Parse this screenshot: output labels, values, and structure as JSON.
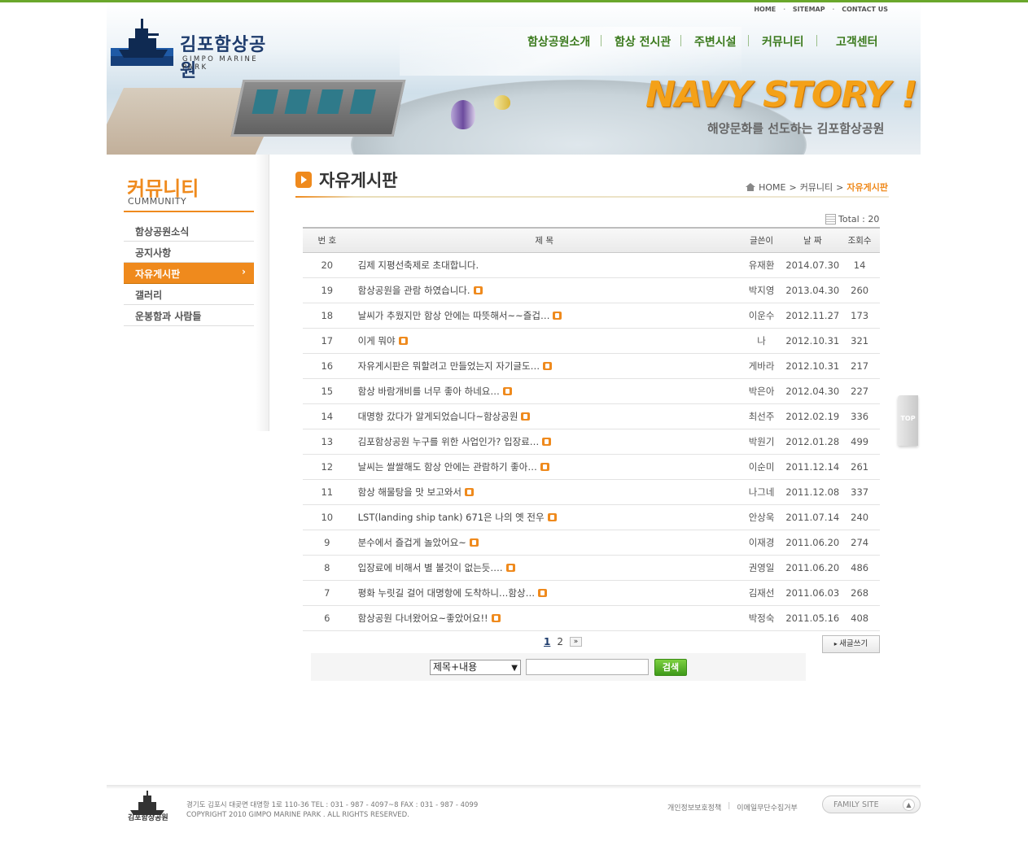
{
  "header": {
    "logo_title": "김포함상공원",
    "logo_sub": "GIMPO MARINE PARK",
    "util_links": [
      "HOME",
      "SITEMAP",
      "CONTACT US"
    ],
    "gnb": [
      "함상공원소개",
      "함상 전시관",
      "주변시설",
      "커뮤니티",
      "고객센터"
    ],
    "banner_title": "NAVY STORY !",
    "banner_sub": "해양문화를 선도하는 김포함상공원"
  },
  "lnb": {
    "title": "커뮤니티",
    "sub": "CUMMUNITY",
    "items": [
      "함상공원소식",
      "공지사항",
      "자유게시판",
      "갤러리",
      "운봉함과 사람들"
    ],
    "active_index": 2
  },
  "content": {
    "title": "자유게시판",
    "breadcrumb": [
      "HOME",
      ">",
      "커뮤니티",
      ">",
      "자유게시판"
    ],
    "total_label": "Total : 20"
  },
  "board": {
    "columns": [
      "번 호",
      "제 목",
      "글쓴이",
      "날 짜",
      "조회수"
    ],
    "rows": [
      {
        "no": "20",
        "title": "김제 지평선축제로 초대합니다.",
        "author": "유재환",
        "date": "2014.07.30",
        "views": "14",
        "new": false
      },
      {
        "no": "19",
        "title": "함상공원을 관람 하였습니다.",
        "author": "박지영",
        "date": "2013.04.30",
        "views": "260",
        "new": true
      },
      {
        "no": "18",
        "title": "날씨가 추웠지만 함상 안에는 따뜻해서~~즐겁…",
        "author": "이운수",
        "date": "2012.11.27",
        "views": "173",
        "new": true
      },
      {
        "no": "17",
        "title": "이게 뭐야",
        "author": "나",
        "date": "2012.10.31",
        "views": "321",
        "new": true
      },
      {
        "no": "16",
        "title": "자유게시판은 뭐할려고 만들었는지 자기글도…",
        "author": "게바라",
        "date": "2012.10.31",
        "views": "217",
        "new": true
      },
      {
        "no": "15",
        "title": "함상 바람개비를 너무 좋아 하네요…",
        "author": "박은아",
        "date": "2012.04.30",
        "views": "227",
        "new": true
      },
      {
        "no": "14",
        "title": "대명항 갔다가 알게되었습니다~함상공원",
        "author": "최선주",
        "date": "2012.02.19",
        "views": "336",
        "new": true
      },
      {
        "no": "13",
        "title": "김포함상공원 누구를 위한 사업인가? 입장료…",
        "author": "박원기",
        "date": "2012.01.28",
        "views": "499",
        "new": true
      },
      {
        "no": "12",
        "title": "날씨는 쌀쌀해도 함상 안에는 관람하기 좋아…",
        "author": "이순미",
        "date": "2011.12.14",
        "views": "261",
        "new": true
      },
      {
        "no": "11",
        "title": "함상 해물탕을 맛 보고와서",
        "author": "나그네",
        "date": "2011.12.08",
        "views": "337",
        "new": true
      },
      {
        "no": "10",
        "title": "LST(landing ship tank) 671은 나의 옛 전우",
        "author": "안상욱",
        "date": "2011.07.14",
        "views": "240",
        "new": true
      },
      {
        "no": "9",
        "title": "분수에서 즐겁게 놀았어요~",
        "author": "이재경",
        "date": "2011.06.20",
        "views": "274",
        "new": true
      },
      {
        "no": "8",
        "title": "입장료에 비해서 별 볼것이 없는듯….",
        "author": "권영일",
        "date": "2011.06.20",
        "views": "486",
        "new": true
      },
      {
        "no": "7",
        "title": "평화 누릿길 걸어 대명항에 도착하니…함상…",
        "author": "김재선",
        "date": "2011.06.03",
        "views": "268",
        "new": true
      },
      {
        "no": "6",
        "title": "함상공원 다녀왔어요~좋았어요!!",
        "author": "박정숙",
        "date": "2011.05.16",
        "views": "408",
        "new": true
      }
    ]
  },
  "pager": {
    "pages": [
      "1",
      "2"
    ],
    "current": "1",
    "next": "»"
  },
  "write_button": "새글쓰기",
  "search": {
    "select_value": "제목+내용",
    "input_value": "",
    "button": "검색"
  },
  "top_button": "TOP",
  "footer": {
    "logo_text": "김포함상공원",
    "address": "경기도 김포시 대곶면 대명항 1로 110-36 TEL : 031 - 987 - 4097~8     FAX : 031 - 987 - 4099",
    "copyright": "COPYRIGHT 2010 GIMPO MARINE PARK . ALL RIGHTS RESERVED.",
    "links": [
      "개인정보보호정책",
      "이메일무단수집거부"
    ],
    "family_site": "FAMILY SITE"
  },
  "colors": {
    "accent": "#ef8a1d",
    "gnb_green": "#3b7a1d",
    "brand_navy": "#1d3b6c",
    "search_green": "#4fae22"
  }
}
